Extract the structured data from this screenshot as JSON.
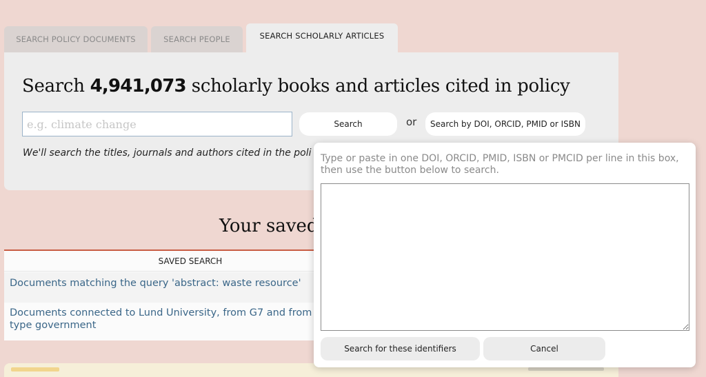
{
  "tabs": [
    {
      "label": "SEARCH POLICY DOCUMENTS",
      "active": false
    },
    {
      "label": "SEARCH PEOPLE",
      "active": false
    },
    {
      "label": "SEARCH SCHOLARLY ARTICLES",
      "active": true
    }
  ],
  "headline": {
    "prefix": "Search ",
    "count": "4,941,073",
    "suffix": " scholarly books and articles cited in policy"
  },
  "search": {
    "placeholder": "e.g. climate change",
    "value": "",
    "button_label": "Search",
    "or_label": "or",
    "id_button_label": "Search by DOI, ORCID, PMID or ISBN"
  },
  "note": "We'll search the titles, journals and authors cited in the poli",
  "saved": {
    "title": "Your saved",
    "column_header": "SAVED SEARCH",
    "rows": [
      {
        "line1": "Documents matching the query 'abstract: waste resource'",
        "line2": ""
      },
      {
        "line1": "Documents connected to Lund University, from G7 and from s",
        "line2": "type government"
      }
    ]
  },
  "popup": {
    "message": "Type or paste in one DOI, ORCID, PMID, ISBN or PMCID per line in this box, then use the button below to search.",
    "textarea_value": "",
    "search_button": "Search for these identifiers",
    "cancel_button": "Cancel"
  },
  "colors": {
    "page_background": "#efd7d1",
    "panel_background": "#ededed",
    "link": "#3a6688",
    "accent_rule": "#c85c43"
  }
}
